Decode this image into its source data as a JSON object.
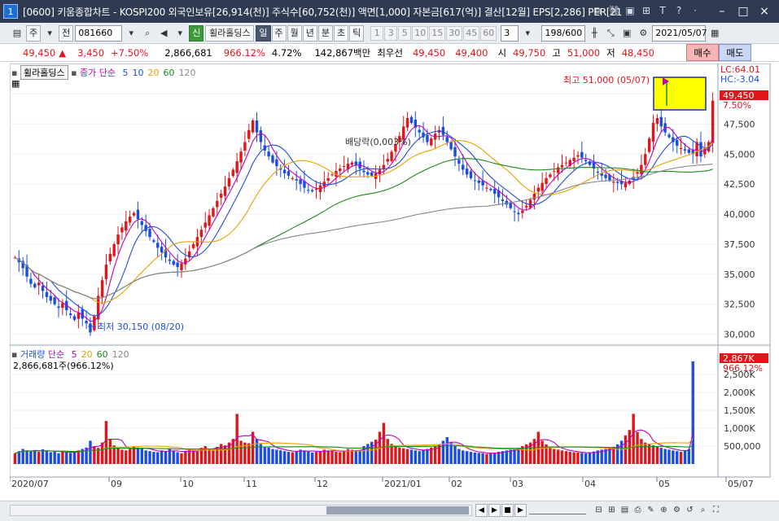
{
  "window": {
    "number": "1",
    "title": "[0600] 키움종합차트 - KOSPI200 외국인보유[26,914(천)] 주식수[60,752(천)] 액면[1,000] 자본금[617(억)] 결산[12월] EPS[2,286] PER[21"
  },
  "toolbar": {
    "market": "주",
    "all": "전",
    "code": "081660",
    "badge": "신",
    "stock_name": "휠라홀딩스",
    "periods": [
      "일",
      "주",
      "월",
      "년",
      "분",
      "초",
      "틱"
    ],
    "active_period": "일",
    "intervals": [
      "1",
      "3",
      "5",
      "10",
      "15",
      "30",
      "45",
      "60"
    ],
    "count_select": "3",
    "range": "198/600",
    "date": "2021/05/07"
  },
  "quote": {
    "price": "49,450",
    "arrow": "▲",
    "change": "3,450",
    "change_pct": "+7.50%",
    "volume": "2,866,681",
    "volume_ratio": "966.12%",
    "turnover": "4.72%",
    "amount": "142,867백만",
    "best_label": "최우선",
    "best_ask": "49,450",
    "best_bid": "49,400",
    "open_label": "시",
    "open": "49,750",
    "high_label": "고",
    "high": "51,000",
    "low_label": "저",
    "low": "48,450",
    "buy_label": "매수",
    "sell_label": "매도"
  },
  "price_panel": {
    "name": "휠라홀딩스",
    "legend_label": "종가 단순",
    "ma": [
      {
        "period": "5",
        "color": "#1b4de0"
      },
      {
        "period": "10",
        "color": "#1b4de0"
      },
      {
        "period": "20",
        "color": "#e8a200"
      },
      {
        "period": "60",
        "color": "#1b8a1b"
      },
      {
        "period": "120",
        "color": "#888888"
      }
    ],
    "high_annot": "최고 51,000 (05/07)",
    "low_annot": "최저 30,150 (08/20)",
    "dividend_annot": "배당락(0,003%)",
    "right_labels": {
      "lc": "LC:64.01",
      "hc": "HC:-3.04",
      "price": "49,450",
      "pct": "7.50%"
    }
  },
  "volume_panel": {
    "label": "거래량",
    "ma_label": "단순",
    "ma": [
      {
        "period": "5",
        "color": "#c000c0"
      },
      {
        "period": "20",
        "color": "#e8a200"
      },
      {
        "period": "60",
        "color": "#1b8a1b"
      },
      {
        "period": "120",
        "color": "#888888"
      }
    ],
    "volume_text": "2,866,681주(966.12%)",
    "right_labels": {
      "vol": "2,867K",
      "pct": "966.12%"
    }
  },
  "x_axis": [
    "2020/07",
    "09",
    "10",
    "11",
    "12",
    "2021/01",
    "02",
    "03",
    "04",
    "05",
    "05/07"
  ],
  "colors": {
    "up": "#e0161b",
    "down": "#1b4de0",
    "ma5": "#c000c0",
    "ma10": "#1b4de0",
    "ma20": "#e8a200",
    "ma60": "#1b8a1b",
    "ma120": "#888888"
  },
  "chart_data": {
    "type": "candlestick",
    "price_axis": [
      "50,000",
      "47,500",
      "45,000",
      "42,500",
      "40,000",
      "37,500",
      "35,000",
      "32,500",
      "30,000"
    ],
    "price_ylim": [
      29500,
      52000
    ],
    "volume_axis": [
      "2,500K",
      "2,000K",
      "1,500K",
      "1,000K",
      "500,000"
    ],
    "volume_ylim": [
      0,
      3000000
    ],
    "closes": [
      36400,
      36000,
      35500,
      34800,
      34200,
      33900,
      34300,
      33600,
      33100,
      32800,
      32500,
      32200,
      32600,
      32000,
      31600,
      31200,
      31800,
      31300,
      30900,
      30150,
      31500,
      33200,
      34500,
      35800,
      36700,
      37500,
      38300,
      38900,
      39400,
      39800,
      40100,
      39600,
      39100,
      38600,
      38100,
      37700,
      37200,
      36800,
      36400,
      36100,
      35800,
      35600,
      35900,
      36300,
      36900,
      37500,
      38100,
      38700,
      39300,
      39900,
      40500,
      41100,
      41700,
      42300,
      43000,
      43700,
      44400,
      45200,
      46000,
      47000,
      47800,
      46800,
      46000,
      45300,
      44800,
      44300,
      44000,
      43700,
      43400,
      43200,
      43000,
      42800,
      42500,
      42200,
      42000,
      41900,
      42100,
      42400,
      42700,
      43000,
      43300,
      43600,
      43800,
      44000,
      44200,
      44300,
      44100,
      43800,
      43500,
      43300,
      43200,
      43400,
      43700,
      44100,
      44600,
      45200,
      45800,
      46500,
      47300,
      48000,
      47600,
      47200,
      46800,
      46400,
      46000,
      46300,
      46700,
      47000,
      46600,
      46000,
      45400,
      44800,
      44200,
      43700,
      43300,
      43000,
      42800,
      42600,
      42400,
      42200,
      42000,
      41700,
      41400,
      41100,
      40800,
      40500,
      40200,
      40000,
      40300,
      40700,
      41200,
      41700,
      42200,
      42600,
      43000,
      43300,
      43600,
      43900,
      44100,
      44300,
      44500,
      44700,
      44900,
      44700,
      44400,
      44100,
      43800,
      43500,
      43200,
      43000,
      42800,
      42700,
      42600,
      42500,
      42600,
      42800,
      43100,
      43500,
      44100,
      45000,
      46300,
      47600,
      48000,
      47300,
      46800,
      46400,
      46000,
      45700,
      45500,
      45300,
      45100,
      45000,
      46000,
      44800,
      45500,
      46000,
      49450
    ],
    "volumes": [
      300000,
      360000,
      420000,
      380000,
      350000,
      390000,
      340000,
      410000,
      360000,
      330000,
      350000,
      300000,
      370000,
      320000,
      310000,
      340000,
      380000,
      420000,
      460000,
      650000,
      500000,
      450000,
      600000,
      1200000,
      700000,
      520000,
      450000,
      400000,
      380000,
      420000,
      500000,
      460000,
      430000,
      380000,
      360000,
      340000,
      330000,
      380000,
      350000,
      420000,
      360000,
      330000,
      300000,
      360000,
      410000,
      380000,
      350000,
      450000,
      500000,
      420000,
      400000,
      480000,
      560000,
      520000,
      600000,
      700000,
      1400000,
      650000,
      600000,
      580000,
      900000,
      700000,
      560000,
      480000,
      460000,
      420000,
      400000,
      380000,
      360000,
      340000,
      330000,
      360000,
      400000,
      380000,
      350000,
      320000,
      340000,
      360000,
      400000,
      380000,
      360000,
      340000,
      330000,
      350000,
      420000,
      400000,
      380000,
      360000,
      500000,
      560000,
      620000,
      680000,
      900000,
      1150000,
      700000,
      560000,
      480000,
      460000,
      440000,
      420000,
      400000,
      380000,
      360000,
      390000,
      420000,
      460000,
      500000,
      550000,
      650000,
      750000,
      600000,
      500000,
      420000,
      380000,
      360000,
      340000,
      320000,
      310000,
      300000,
      280000,
      300000,
      320000,
      340000,
      360000,
      380000,
      400000,
      420000,
      450000,
      500000,
      550000,
      600000,
      700000,
      900000,
      650000,
      550000,
      480000,
      420000,
      400000,
      380000,
      360000,
      340000,
      330000,
      320000,
      310000,
      300000,
      320000,
      350000,
      380000,
      400000,
      420000,
      450000,
      480000,
      550000,
      650000,
      800000,
      950000,
      1400000,
      900000,
      700000,
      600000,
      560000,
      520000,
      480000,
      450000,
      420000,
      400000,
      380000,
      360000,
      340000,
      380000,
      420000,
      2866681
    ]
  }
}
